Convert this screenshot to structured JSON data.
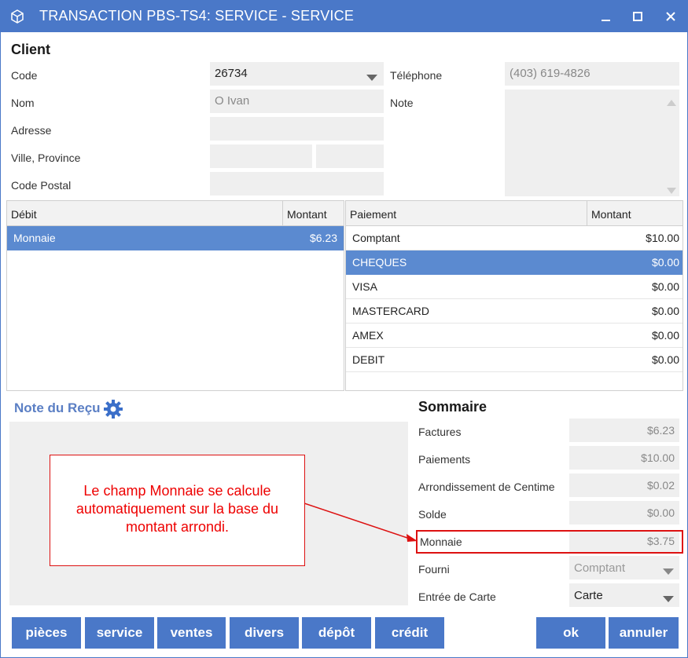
{
  "window": {
    "title": "TRANSACTION PBS-TS4: SERVICE - SERVICE",
    "accent": "#4a78c8"
  },
  "icons": {
    "app": "cube-icon",
    "minimize": "minimize-icon",
    "maximize": "maximize-icon",
    "close": "close-icon",
    "gear": "gear-icon",
    "dropdown": "chevron-down-icon"
  },
  "client": {
    "title": "Client",
    "code_label": "Code",
    "code_value": "26734",
    "nom_label": "Nom",
    "nom_value": "O Ivan",
    "adresse_label": "Adresse",
    "adresse_value": "",
    "ville_label": "Ville, Province",
    "ville_value": "",
    "province_value": "",
    "postal_label": "Code Postal",
    "postal_value": "",
    "tel_label": "Téléphone",
    "tel_value": "(403) 619-4826",
    "note_label": "Note",
    "note_value": ""
  },
  "debit": {
    "col_name": "Débit",
    "col_amount": "Montant",
    "rows": [
      {
        "name": "Monnaie",
        "amount": "$6.23",
        "selected": true
      }
    ]
  },
  "paiement": {
    "col_name": "Paiement",
    "col_amount": "Montant",
    "rows": [
      {
        "name": "Comptant",
        "amount": "$10.00",
        "selected": false
      },
      {
        "name": "CHEQUES",
        "amount": "$0.00",
        "selected": true
      },
      {
        "name": "VISA",
        "amount": "$0.00",
        "selected": false
      },
      {
        "name": "MASTERCARD",
        "amount": "$0.00",
        "selected": false
      },
      {
        "name": "AMEX",
        "amount": "$0.00",
        "selected": false
      },
      {
        "name": "DEBIT",
        "amount": "$0.00",
        "selected": false
      }
    ]
  },
  "note_recu": {
    "title": "Note du Reçu"
  },
  "sommaire": {
    "title": "Sommaire",
    "factures_label": "Factures",
    "factures_value": "$6.23",
    "paiements_label": "Paiements",
    "paiements_value": "$10.00",
    "arrondi_label": "Arrondissement de Centime",
    "arrondi_value": "$0.02",
    "solde_label": "Solde",
    "solde_value": "$0.00",
    "monnaie_label": "Monnaie",
    "monnaie_value": "$3.75",
    "fourni_label": "Fourni",
    "fourni_value": "Comptant",
    "entree_label": "Entrée de Carte",
    "entree_value": "Carte"
  },
  "callout": {
    "text": "Le champ Monnaie se calcule automatiquement sur la base du montant arrondi.",
    "color": "#e00000"
  },
  "buttons": {
    "pieces": "pièces",
    "service": "service",
    "ventes": "ventes",
    "divers": "divers",
    "depot": "dépôt",
    "credit": "crédit",
    "ok": "ok",
    "annuler": "annuler"
  }
}
